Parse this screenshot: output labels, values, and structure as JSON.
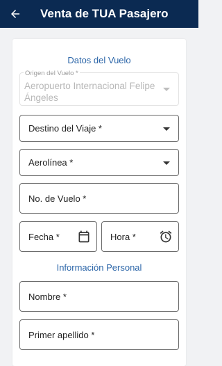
{
  "appbar": {
    "title": "Venta de TUA Pasajero",
    "back_icon": "arrow-back-icon"
  },
  "flight_section": {
    "heading": "Datos del Vuelo",
    "origin": {
      "label": "Origen del Vuelo *",
      "value": "Aeropuerto Internacional Felipe Ángeles"
    },
    "destination": {
      "label": "Destino del Viaje *"
    },
    "airline": {
      "label": "Aerolínea *"
    },
    "flight_number": {
      "label": "No. de Vuelo *"
    },
    "date": {
      "label": "Fecha *",
      "icon": "calendar-icon"
    },
    "time": {
      "label": "Hora *",
      "icon": "alarm-clock-icon"
    }
  },
  "personal_section": {
    "heading": "Información Personal",
    "first_name": {
      "label": "Nombre *"
    },
    "last_name": {
      "label": "Primer apellido *"
    }
  },
  "colors": {
    "appbar": "#0b2a52",
    "accent": "#2b65a8",
    "background": "#f1f2f4"
  }
}
